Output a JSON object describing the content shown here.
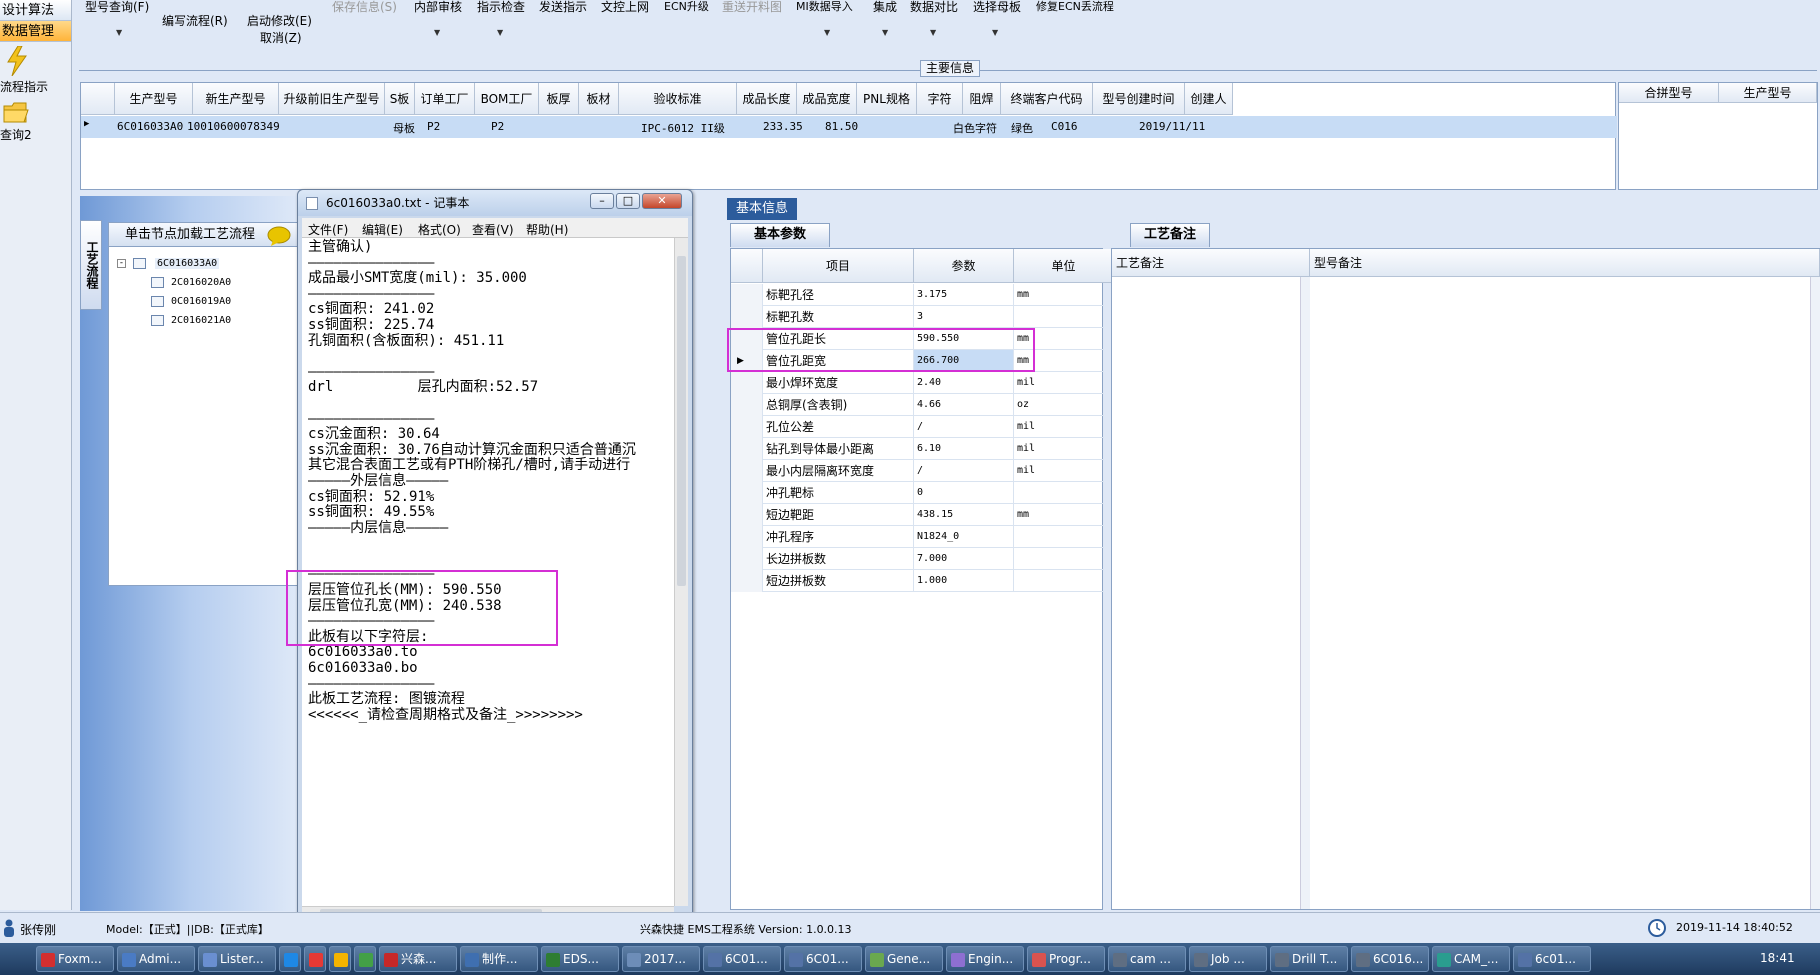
{
  "leftnav": {
    "header1": "设计算法",
    "header2": "数据管理",
    "item1": "流程指示",
    "item2": "查询2"
  },
  "toolbar": {
    "row1": [
      "型号查询(F)",
      "保存信息(S)",
      "内部审核",
      "指示检查",
      "发送指示",
      "文控上网",
      "ECN升级",
      "重送开料图",
      "MI数据导入",
      "集成",
      "数据对比",
      "选择母板",
      "修复ECN丢流程"
    ],
    "row2": [
      "编写流程(R)",
      "启动修改(E)"
    ],
    "row3": [
      "取消(Z)"
    ]
  },
  "main_label": "主要信息",
  "grid1": {
    "headers": [
      "生产型号",
      "新生产型号",
      "升级前旧生产型号",
      "S板",
      "订单工厂",
      "BOM工厂",
      "板厚",
      "板材",
      "验收标准",
      "成品长度",
      "成品宽度",
      "PNL规格",
      "字符",
      "阻焊",
      "终端客户代码",
      "型号创建时间",
      "创建人"
    ],
    "row": [
      "6C016033A0",
      "10010600078349",
      "",
      "母板",
      "P2",
      "P2",
      "",
      "",
      "IPC-6012 II级",
      "233.35",
      "81.50",
      "",
      "白色字符",
      "绿色",
      "C016",
      "2019/11/11",
      ""
    ]
  },
  "merge_grid": {
    "headers": [
      "合拼型号",
      "生产型号"
    ]
  },
  "tree": {
    "tab_label": "工艺流程",
    "header": "单击节点加载工艺流程",
    "root": "6C016033A0",
    "children": [
      "2C016020A0",
      "0C016019A0",
      "2C016021A0"
    ]
  },
  "notepad": {
    "title": "6c016033a0.txt - 记事本",
    "menu": [
      "文件(F)",
      "编辑(E)",
      "格式(O)",
      "查看(V)",
      "帮助(H)"
    ],
    "lines": [
      "主管确认)",
      "———————————————",
      "成品最小SMT宽度(mil): 35.000",
      "———————————————",
      "cs铜面积: 241.02",
      "ss铜面积: 225.74",
      "孔铜面积(含板面积): 451.11",
      "",
      "———————————————",
      "drl          层孔内面积:52.57",
      "",
      "———————————————",
      "cs沉金面积: 30.64",
      "ss沉金面积: 30.76自动计算沉金面积只适合普通沉",
      "其它混合表面工艺或有PTH阶梯孔/槽时,请手动进行",
      "—————外层信息—————",
      "cs铜面积: 52.91%",
      "ss铜面积: 49.55%",
      "—————内层信息—————",
      "",
      "",
      "———————————————",
      "层压管位孔长(MM): 590.550",
      "层压管位孔宽(MM): 240.538",
      "———————————————",
      "此板有以下字符层:",
      "6c016033a0.to",
      "6c016033a0.bo",
      "———————————————",
      "此板工艺流程: 图镀流程",
      "<<<<<<_请检查周期格式及备注_>>>>>>>>"
    ]
  },
  "basic_info": {
    "header": "基本信息",
    "tab": "基本参数",
    "columns": [
      "项目",
      "参数",
      "单位"
    ],
    "rows": [
      {
        "item": "标靶孔径",
        "value": "3.175",
        "unit": "mm"
      },
      {
        "item": "标靶孔数",
        "value": "3",
        "unit": ""
      },
      {
        "item": "管位孔距长",
        "value": "590.550",
        "unit": "mm"
      },
      {
        "item": "管位孔距宽",
        "value": "266.700",
        "unit": "mm"
      },
      {
        "item": "最小焊环宽度",
        "value": "2.40",
        "unit": "mil"
      },
      {
        "item": "总铜厚(含表铜)",
        "value": "4.66",
        "unit": "oz"
      },
      {
        "item": "孔位公差",
        "value": "/",
        "unit": "mil"
      },
      {
        "item": "钻孔到导体最小距离",
        "value": "6.10",
        "unit": "mil"
      },
      {
        "item": "最小内层隔离环宽度",
        "value": "/",
        "unit": "mil"
      },
      {
        "item": "冲孔靶标",
        "value": "0",
        "unit": ""
      },
      {
        "item": "短边靶距",
        "value": "438.15",
        "unit": "mm"
      },
      {
        "item": "冲孔程序",
        "value": "N1824_0",
        "unit": ""
      },
      {
        "item": "长边拼板数",
        "value": "7.000",
        "unit": ""
      },
      {
        "item": "短边拼板数",
        "value": "1.000",
        "unit": ""
      }
    ]
  },
  "process_notes": {
    "tab": "工艺备注",
    "columns": [
      "工艺备注",
      "型号备注"
    ]
  },
  "status": {
    "user": "张传刚",
    "model": "Model:【正式】||DB:【正式库】",
    "app": "兴森快捷 EMS工程系统 Version: 1.0.0.13",
    "datetime": "2019-11-14 18:40:52"
  },
  "taskbar": {
    "items": [
      "Foxm...",
      "Admi...",
      "Lister...",
      "",
      "",
      "",
      "",
      "兴森...",
      "制作...",
      "EDS...",
      "2017...",
      "6C01...",
      "6C01...",
      "Gene...",
      "Engin...",
      "Progr...",
      "cam ...",
      "Job ...",
      "Drill T...",
      "6C016...",
      "CAM_...",
      "6c01..."
    ],
    "clock": "18:41"
  },
  "colors": {
    "accent": "#2c5c9c",
    "highlight": "#d42fd4",
    "selected_row": "#c7dcf5"
  }
}
